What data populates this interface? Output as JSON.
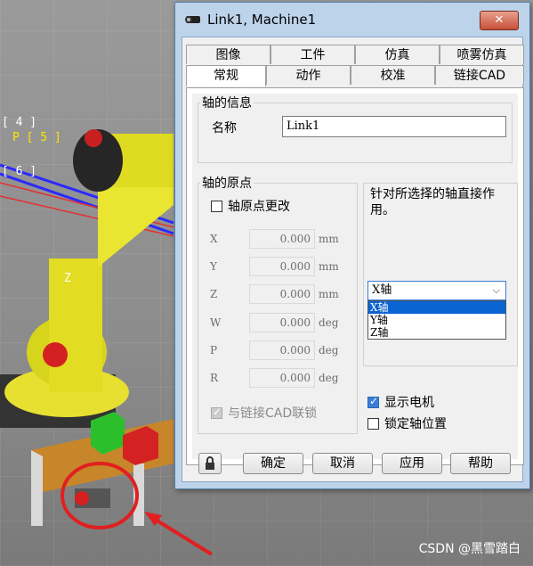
{
  "scene": {
    "labels": [
      "[ 4 ]",
      "P [ 5 ]",
      "[ 6 ]",
      "Z"
    ],
    "watermark": "CSDN @黑雪踏白"
  },
  "dialog": {
    "title": "Link1, Machine1",
    "close_label": "✕",
    "tabs_row1": [
      "图像",
      "工件",
      "仿真",
      "喷雾仿真"
    ],
    "tabs_row2": [
      "常规",
      "动作",
      "校准",
      "链接CAD"
    ],
    "active_tab": "常规",
    "axis_info": {
      "legend": "轴的信息",
      "name_label": "名称",
      "name_value": "Link1"
    },
    "axis_origin": {
      "legend": "轴的原点",
      "change_label": "轴原点更改",
      "rows": [
        {
          "axis": "X",
          "value": "0.000",
          "unit": "mm"
        },
        {
          "axis": "Y",
          "value": "0.000",
          "unit": "mm"
        },
        {
          "axis": "Z",
          "value": "0.000",
          "unit": "mm"
        },
        {
          "axis": "W",
          "value": "0.000",
          "unit": "deg"
        },
        {
          "axis": "P",
          "value": "0.000",
          "unit": "deg"
        },
        {
          "axis": "R",
          "value": "0.000",
          "unit": "deg"
        }
      ],
      "cad_lock_label": "与链接CAD联锁"
    },
    "right": {
      "description": "针对所选择的轴直接作用。",
      "combo_value": "X轴",
      "options": [
        "X轴",
        "Y轴",
        "Z轴"
      ],
      "show_motor_label": "显示电机",
      "lock_axis_label": "锁定轴位置"
    },
    "buttons": {
      "ok": "确定",
      "cancel": "取消",
      "apply": "应用",
      "help": "帮助"
    }
  }
}
